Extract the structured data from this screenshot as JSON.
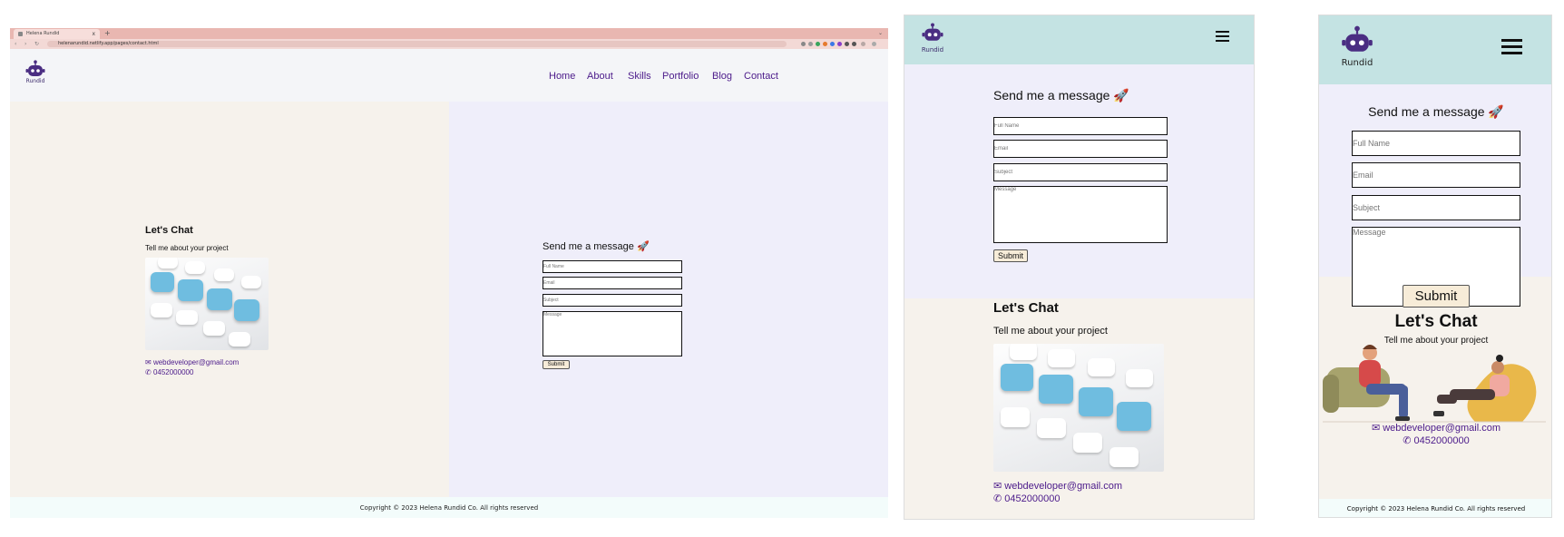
{
  "browser": {
    "tab_title": "Helena Rundid",
    "tab_close": "x",
    "new_tab": "+",
    "tab_menu": "⌄",
    "url": "helenarundid.netlify.app/pages/contact.html",
    "back": "‹",
    "forward": "›",
    "reload": "↻"
  },
  "brand": {
    "name": "Rundid",
    "colors": {
      "accent": "#4b1a8a",
      "header_teal": "#c4e3e3",
      "form_bg": "#efeefa",
      "chat_bg": "#f6f2ec"
    }
  },
  "nav": {
    "items": [
      "Home",
      "About",
      "Skills",
      "Portfolio",
      "Blog",
      "Contact"
    ],
    "menu_icon": "hamburger-icon"
  },
  "chat": {
    "heading": "Let's Chat",
    "subheading": "Tell me about your project",
    "email": "webdeveloper@gmail.com",
    "phone": "0452000000",
    "email_icon": "envelope-icon",
    "phone_icon": "phone-icon"
  },
  "form": {
    "heading": "Send me a message 🚀",
    "placeholders": {
      "name": "Full Name",
      "email": "Email",
      "subject": "Subject",
      "message": "Message"
    },
    "submit": "Submit"
  },
  "footer": {
    "copyright": "Copyright © 2023 Helena Rundid Co. All rights reserved"
  }
}
